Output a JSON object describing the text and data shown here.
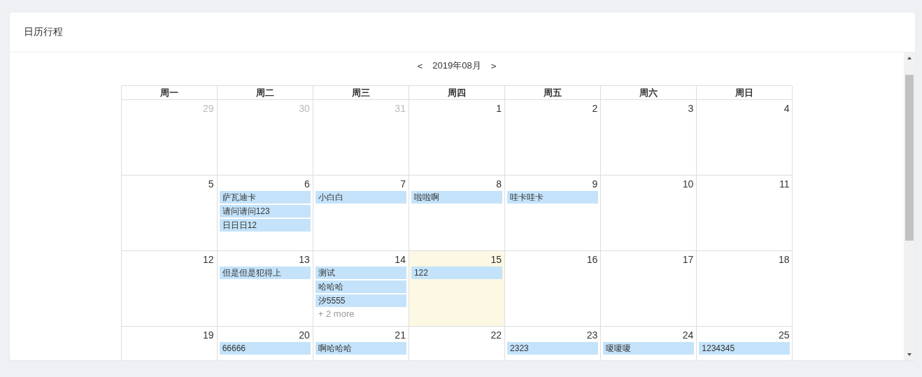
{
  "panel": {
    "title": "日历行程"
  },
  "toolbar": {
    "prev": "<",
    "month": "2019年08月",
    "next": ">"
  },
  "weekdays": [
    "周一",
    "周二",
    "周三",
    "周四",
    "周五",
    "周六",
    "周日"
  ],
  "weeks": [
    [
      {
        "day": "29",
        "other_month": true,
        "today": false
      },
      {
        "day": "30",
        "other_month": true,
        "today": false
      },
      {
        "day": "31",
        "other_month": true,
        "today": false
      },
      {
        "day": "1",
        "other_month": false,
        "today": false
      },
      {
        "day": "2",
        "other_month": false,
        "today": false
      },
      {
        "day": "3",
        "other_month": false,
        "today": false
      },
      {
        "day": "4",
        "other_month": false,
        "today": false
      }
    ],
    [
      {
        "day": "5",
        "other_month": false,
        "today": false
      },
      {
        "day": "6",
        "other_month": false,
        "today": false,
        "events": [
          "萨瓦迪卡",
          "请问请问123",
          "日日日12"
        ]
      },
      {
        "day": "7",
        "other_month": false,
        "today": false,
        "events": [
          "小白白"
        ]
      },
      {
        "day": "8",
        "other_month": false,
        "today": false,
        "events": [
          "啦啦啊"
        ]
      },
      {
        "day": "9",
        "other_month": false,
        "today": false,
        "events": [
          "哇卡哇卡"
        ]
      },
      {
        "day": "10",
        "other_month": false,
        "today": false
      },
      {
        "day": "11",
        "other_month": false,
        "today": false
      }
    ],
    [
      {
        "day": "12",
        "other_month": false,
        "today": false
      },
      {
        "day": "13",
        "other_month": false,
        "today": false,
        "events": [
          "但是但是犯得上"
        ]
      },
      {
        "day": "14",
        "other_month": false,
        "today": false,
        "events": [
          "测试",
          "哈哈哈",
          "汐5555"
        ],
        "more": "+ 2 more"
      },
      {
        "day": "15",
        "other_month": false,
        "today": true,
        "events": [
          "122"
        ]
      },
      {
        "day": "16",
        "other_month": false,
        "today": false
      },
      {
        "day": "17",
        "other_month": false,
        "today": false
      },
      {
        "day": "18",
        "other_month": false,
        "today": false
      }
    ],
    [
      {
        "day": "19",
        "other_month": false,
        "today": false
      },
      {
        "day": "20",
        "other_month": false,
        "today": false,
        "events": [
          "66666"
        ]
      },
      {
        "day": "21",
        "other_month": false,
        "today": false,
        "events": [
          "啊哈哈哈"
        ]
      },
      {
        "day": "22",
        "other_month": false,
        "today": false
      },
      {
        "day": "23",
        "other_month": false,
        "today": false,
        "events": [
          "2323"
        ]
      },
      {
        "day": "24",
        "other_month": false,
        "today": false,
        "events": [
          "嗄嗄嗄"
        ]
      },
      {
        "day": "25",
        "other_month": false,
        "today": false,
        "events": [
          "1234345"
        ]
      }
    ]
  ]
}
